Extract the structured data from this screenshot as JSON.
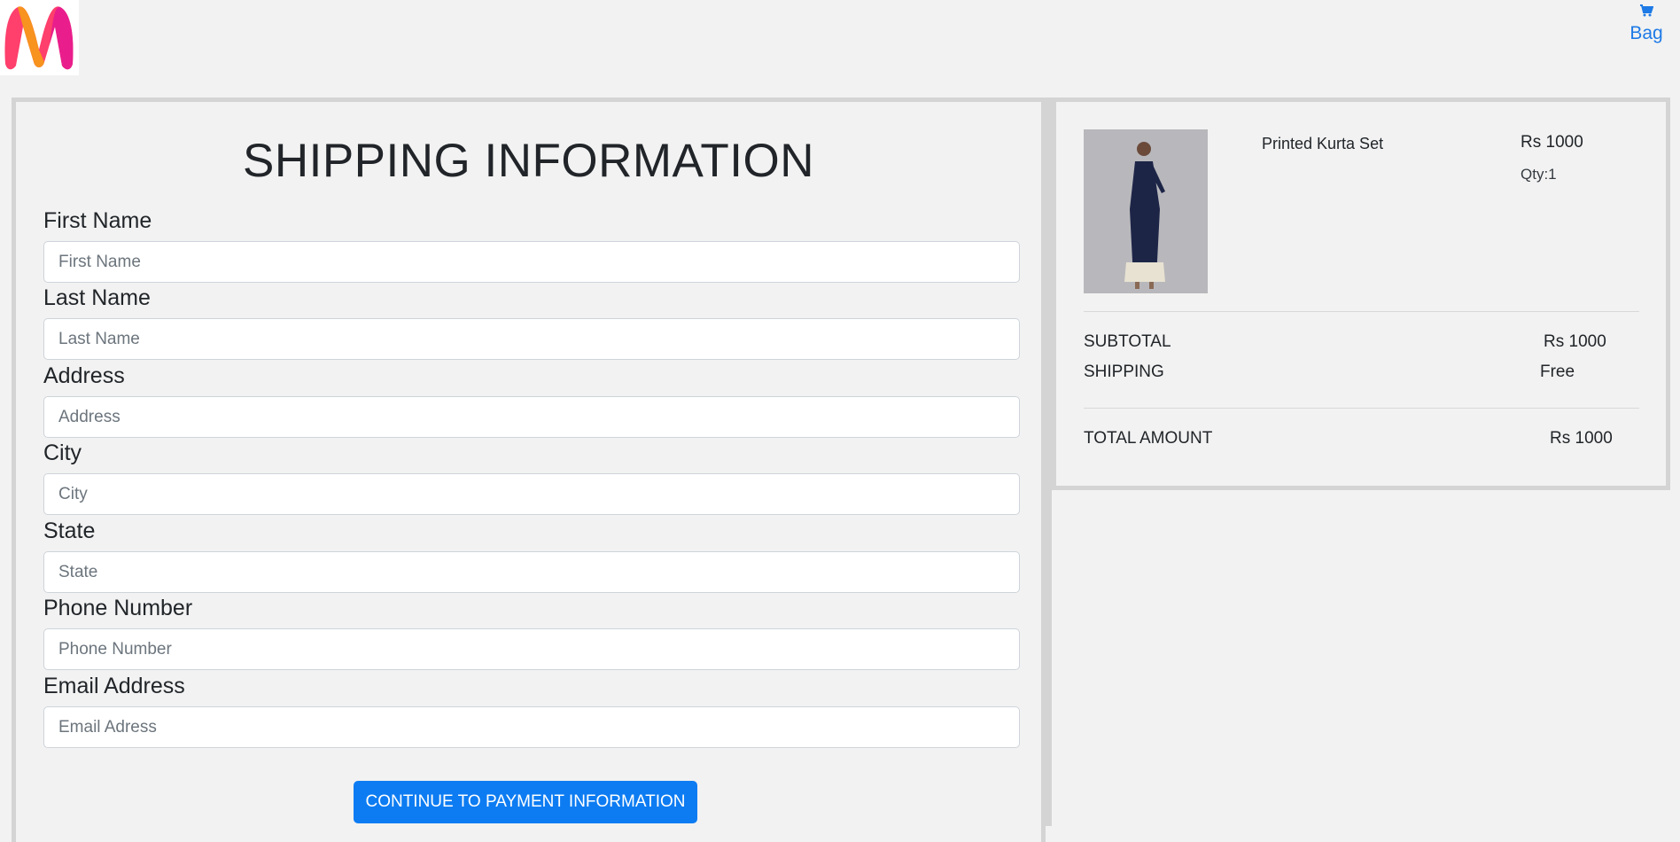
{
  "header": {
    "bag_label": "Bag",
    "brand_colors": [
      "#ff3f6c",
      "#f7931e",
      "#e91e8c"
    ]
  },
  "form": {
    "title": "SHIPPING INFORMATION",
    "fields": [
      {
        "label": "First Name",
        "placeholder": "First Name"
      },
      {
        "label": "Last Name",
        "placeholder": "Last Name"
      },
      {
        "label": "Address",
        "placeholder": "Address"
      },
      {
        "label": "City",
        "placeholder": "City"
      },
      {
        "label": "State",
        "placeholder": "State"
      },
      {
        "label": "Phone Number",
        "placeholder": "Phone Number"
      },
      {
        "label": "Email Address",
        "placeholder": "Email Adress"
      }
    ],
    "submit_label": "CONTINUE TO PAYMENT INFORMATION",
    "accent_color": "#0d7cf2"
  },
  "summary": {
    "item": {
      "name": "Printed Kurta Set",
      "price": "Rs 1000",
      "qty": "Qty:1"
    },
    "subtotal_label": "SUBTOTAL",
    "subtotal_value": "Rs 1000",
    "shipping_label": "SHIPPING",
    "shipping_value": "Free",
    "total_label": "TOTAL AMOUNT",
    "total_value": "Rs 1000"
  }
}
